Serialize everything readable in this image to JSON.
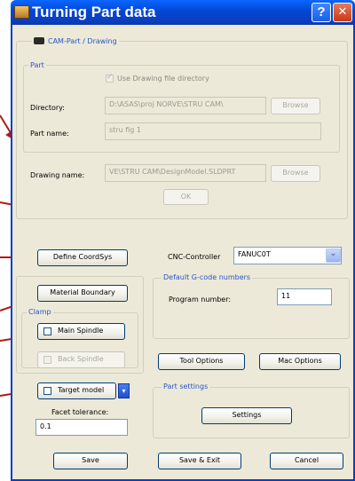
{
  "window": {
    "title": "Turning Part data",
    "help": "?",
    "close": "✕"
  },
  "cam_group": {
    "label": "CAM-Part / Drawing"
  },
  "part_group": {
    "label": "Part",
    "use_drawing_dir": "Use Drawing file directory",
    "directory_label": "Directory:",
    "directory_value": "D:\\ASAS\\proj NORVE\\STRU CAM\\",
    "part_name_label": "Part name:",
    "part_name_value": "stru fig 1",
    "browse": "Browse"
  },
  "drawing": {
    "label": "Drawing name:",
    "value": "VE\\STRU CAM\\DesignModel.SLDPRT",
    "browse": "Browse",
    "ok": "OK"
  },
  "coordsys": {
    "button": "Define CoordSys"
  },
  "cnc": {
    "label": "CNC-Controller",
    "value": "FANUC0T",
    "chevron": "⌄"
  },
  "gcode": {
    "label": "Default G-code numbers",
    "program_label": "Program number:",
    "program_value": "11"
  },
  "material": {
    "button": "Material Boundary"
  },
  "clamp": {
    "label": "Clamp",
    "main_spindle": "Main Spindle",
    "back_spindle": "Back Spindle"
  },
  "target": {
    "label": "Target model",
    "facet_label": "Facet tolerance:",
    "facet_value": "0.1"
  },
  "options": {
    "tool": "Tool Options",
    "mac": "Mac Options"
  },
  "part_settings": {
    "label": "Part settings",
    "button": "Settings"
  },
  "footer": {
    "save": "Save",
    "save_exit": "Save & Exit",
    "cancel": "Cancel"
  },
  "colors": {
    "title_bar": "#0346d2",
    "group_label": "#2a55c8",
    "annotation_arrow": "#b01818"
  }
}
